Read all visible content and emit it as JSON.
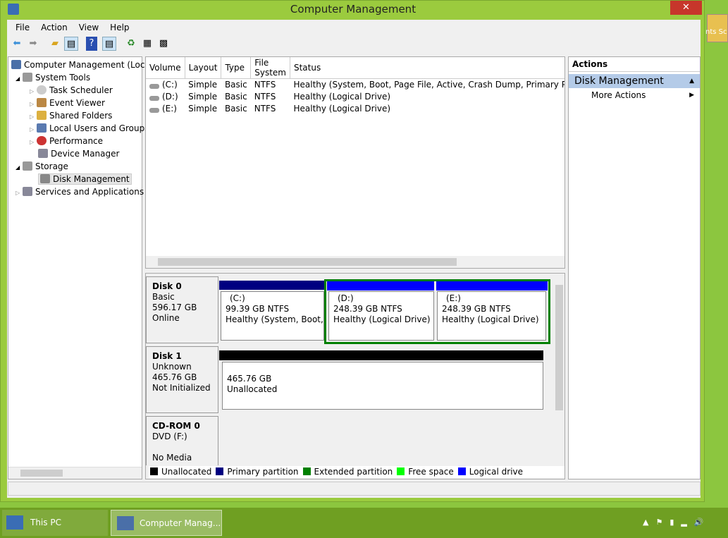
{
  "window": {
    "title": "Computer Management",
    "close": "✕"
  },
  "menu": [
    "File",
    "Action",
    "View",
    "Help"
  ],
  "toolbar": [
    "back",
    "forward",
    "up",
    "show-hide-tree",
    "help",
    "show-hide-action",
    "refresh",
    "properties",
    "settings"
  ],
  "tree": [
    {
      "label": "Computer Management (Local",
      "level": 0
    },
    {
      "label": "System Tools",
      "level": 1,
      "exp": "◢"
    },
    {
      "label": "Task Scheduler",
      "level": 2,
      "exp": "▷"
    },
    {
      "label": "Event Viewer",
      "level": 2,
      "exp": "▷"
    },
    {
      "label": "Shared Folders",
      "level": 2,
      "exp": "▷"
    },
    {
      "label": "Local Users and Groups",
      "level": 2,
      "exp": "▷"
    },
    {
      "label": "Performance",
      "level": 2,
      "exp": "▷"
    },
    {
      "label": "Device Manager",
      "level": 2,
      "exp": ""
    },
    {
      "label": "Storage",
      "level": 1,
      "exp": "◢"
    },
    {
      "label": "Disk Management",
      "level": 2,
      "exp": "",
      "selected": true
    },
    {
      "label": "Services and Applications",
      "level": 1,
      "exp": "▷"
    }
  ],
  "volumes": {
    "columns": [
      "Volume",
      "Layout",
      "Type",
      "File System",
      "Status"
    ],
    "rows": [
      [
        "(C:)",
        "Simple",
        "Basic",
        "NTFS",
        "Healthy (System, Boot, Page File, Active, Crash Dump, Primary Partition"
      ],
      [
        "(D:)",
        "Simple",
        "Basic",
        "NTFS",
        "Healthy (Logical Drive)"
      ],
      [
        "(E:)",
        "Simple",
        "Basic",
        "NTFS",
        "Healthy (Logical Drive)"
      ]
    ]
  },
  "disks": [
    {
      "name": "Disk 0",
      "type": "Basic",
      "size": "596.17 GB",
      "status": "Online"
    },
    {
      "name": "Disk 1",
      "type": "Unknown",
      "size": "465.76 GB",
      "status": "Not Initialized"
    },
    {
      "name": "CD-ROM 0",
      "type": "DVD (F:)",
      "size": "",
      "status": "No Media"
    }
  ],
  "partitions": {
    "c": {
      "label": "(C:)",
      "size": "99.39 GB NTFS",
      "status": "Healthy (System, Boot, Pa"
    },
    "d": {
      "label": "(D:)",
      "size": "248.39 GB NTFS",
      "status": "Healthy (Logical Drive)"
    },
    "e": {
      "label": "(E:)",
      "size": "248.39 GB NTFS",
      "status": "Healthy (Logical Drive)"
    },
    "u": {
      "size": "465.76 GB",
      "status": "Unallocated"
    }
  },
  "legend": [
    {
      "label": "Unallocated",
      "color": "#000000"
    },
    {
      "label": "Primary partition",
      "color": "#000080"
    },
    {
      "label": "Extended partition",
      "color": "#008000"
    },
    {
      "label": "Free space",
      "color": "#00ff00"
    },
    {
      "label": "Logical drive",
      "color": "#0000ff"
    }
  ],
  "actions": {
    "header": "Actions",
    "section": "Disk Management",
    "item": "More Actions"
  },
  "taskbar": {
    "items": [
      "This PC",
      "Computer Manag..."
    ]
  },
  "desktop": {
    "partial": "nts Sc"
  }
}
